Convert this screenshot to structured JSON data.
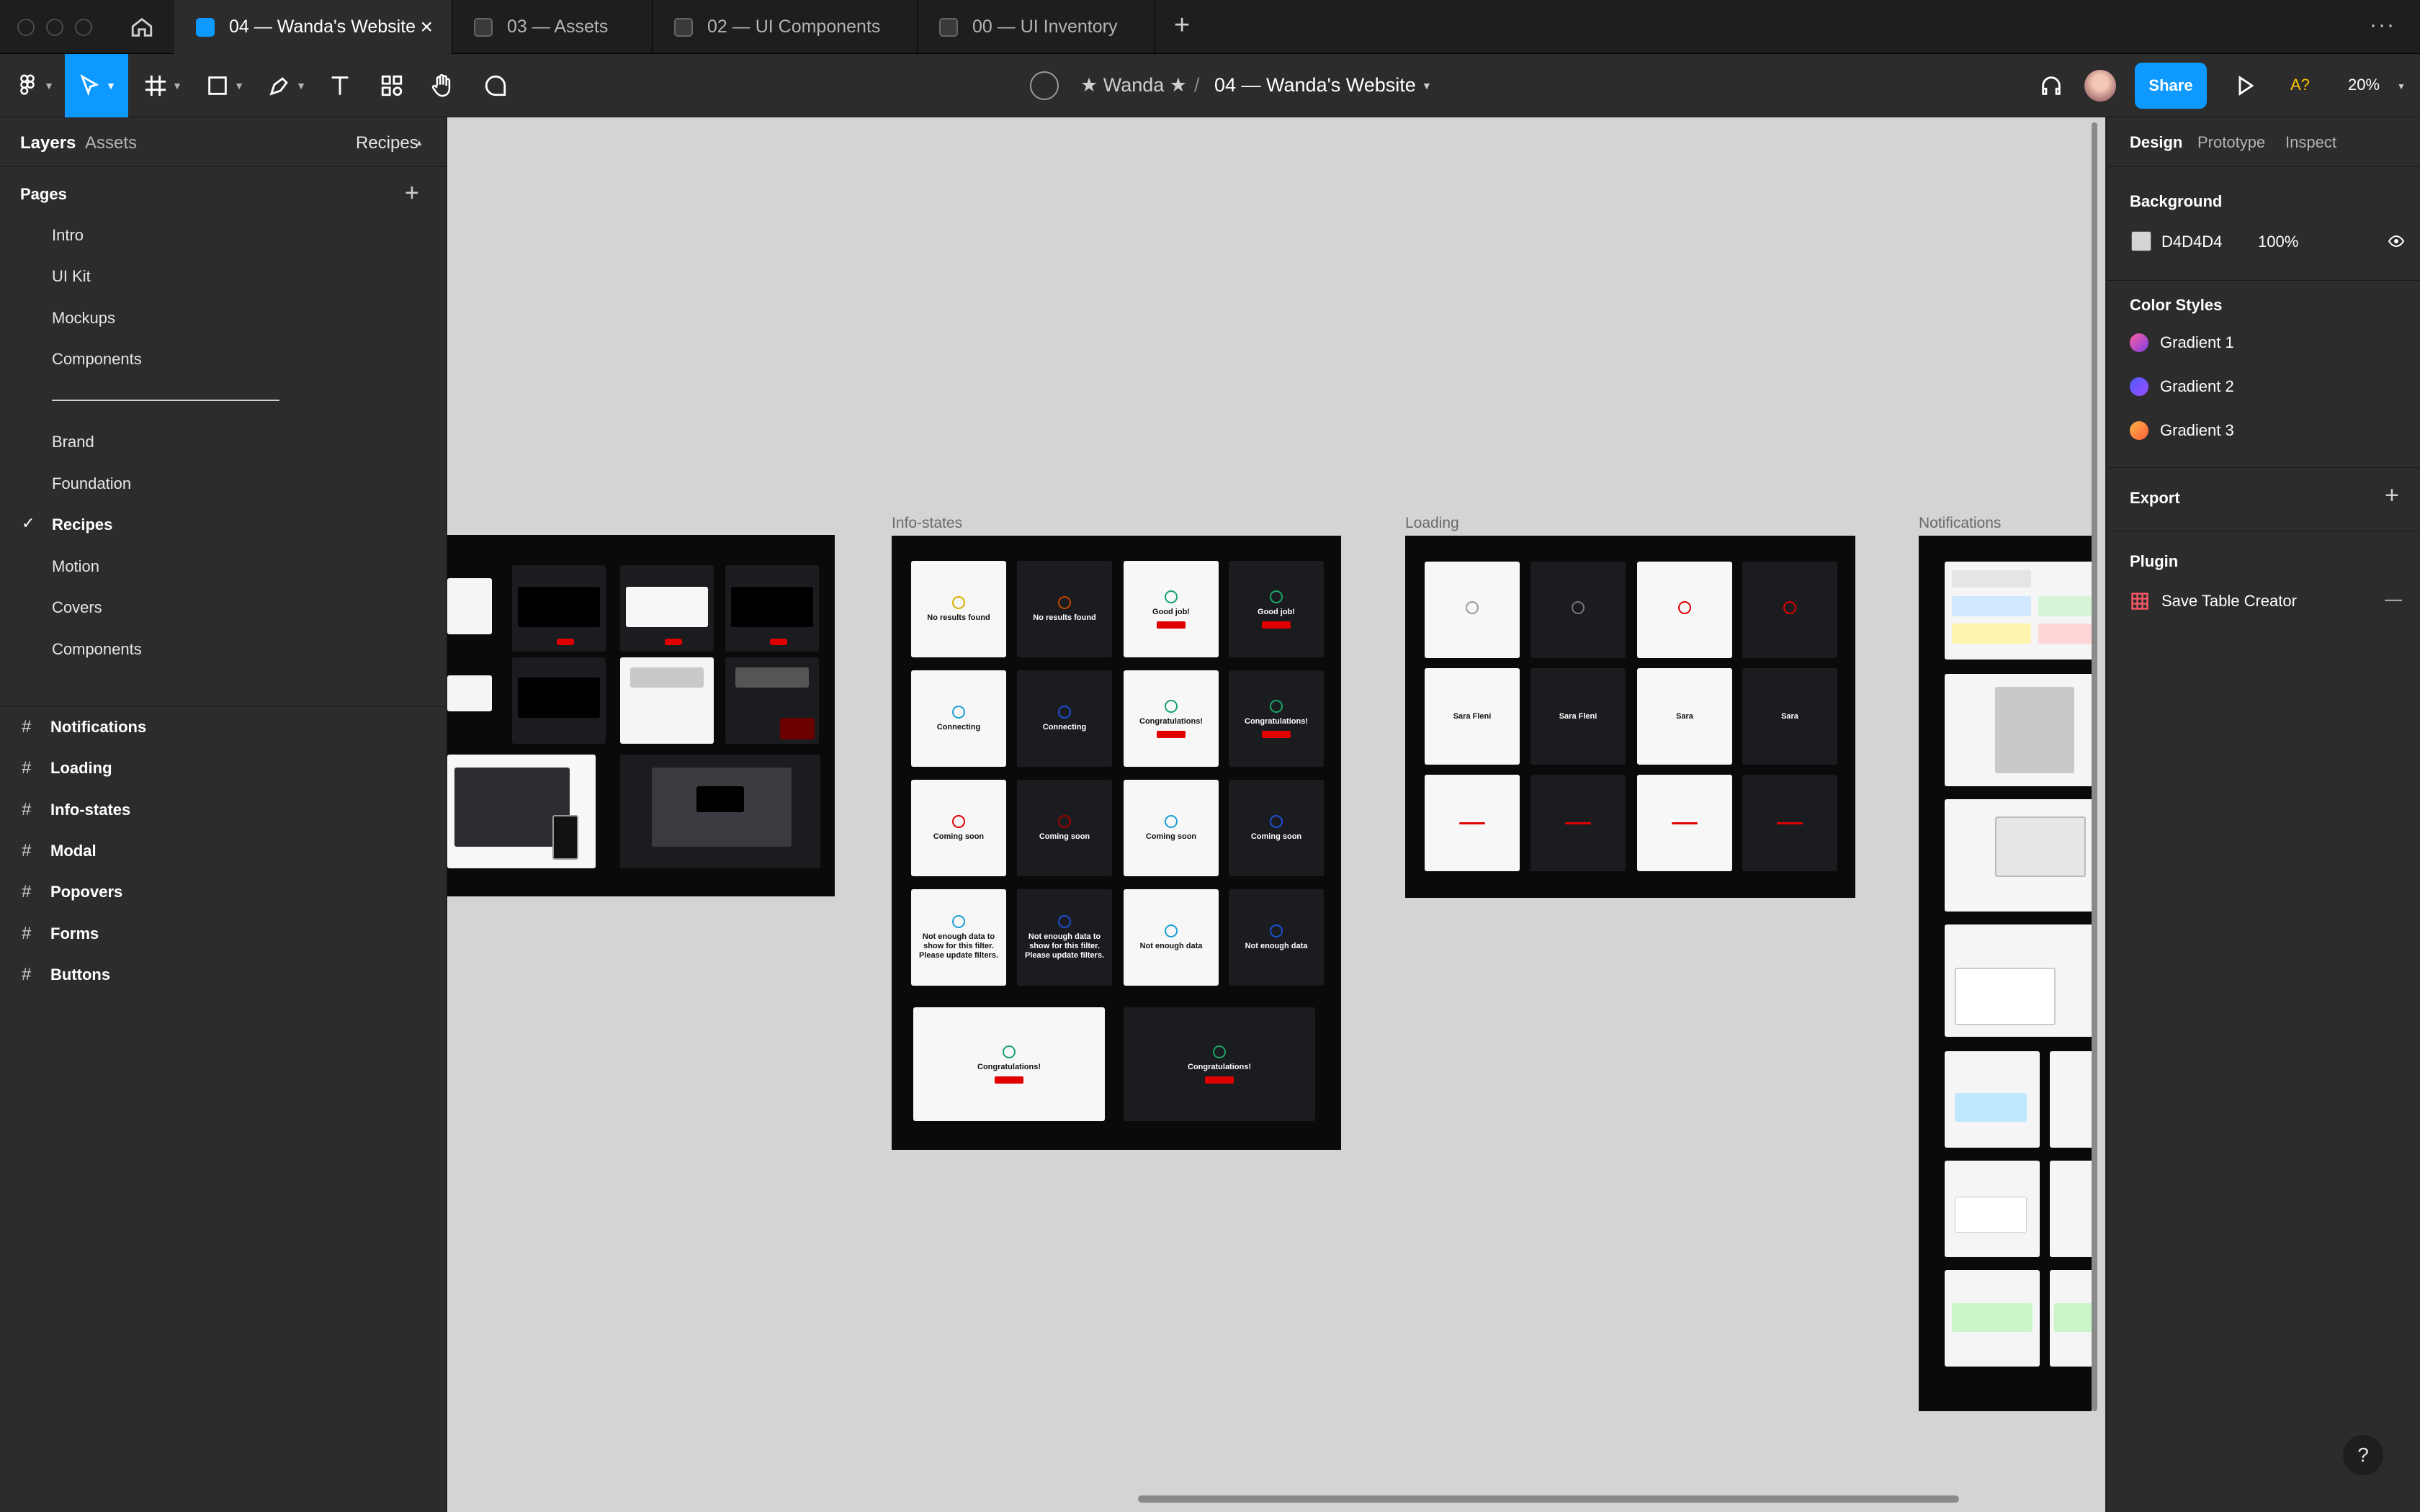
{
  "tabs": [
    {
      "label": "04 — Wanda's Website",
      "active": true
    },
    {
      "label": "03 — Assets"
    },
    {
      "label": "02 — UI Components"
    },
    {
      "label": "00 — UI Inventory"
    }
  ],
  "tab_close": "×",
  "new_tab": "+",
  "more_menu": "···",
  "breadcrumb": {
    "team": "★ Wanda ★",
    "separator": "/",
    "file": "04 — Wanda's Website"
  },
  "share_label": "Share",
  "missing_fonts": "A?",
  "zoom": "20%",
  "left_tabs": {
    "layers": "Layers",
    "assets": "Assets",
    "recipes": "Recipes"
  },
  "pages_title": "Pages",
  "add_icon": "+",
  "pages": [
    "Intro",
    "UI Kit",
    "Mockups",
    "Components",
    "────────────────",
    "Brand",
    "Foundation",
    "Recipes",
    "Motion",
    "Covers",
    "Components"
  ],
  "current_page_check": "✓",
  "layers": [
    "Notifications",
    "Loading",
    "Info-states",
    "Modal",
    "Popovers",
    "Forms",
    "Buttons"
  ],
  "layer_hash": "#",
  "right_tabs": {
    "design": "Design",
    "prototype": "Prototype",
    "inspect": "Inspect"
  },
  "background": {
    "title": "Background",
    "hex": "D4D4D4",
    "opacity": "100%",
    "color": "#d4d4d4"
  },
  "color_styles": {
    "title": "Color Styles",
    "items": [
      {
        "name": "Gradient 1",
        "gradient": "linear-gradient(135deg,#ff5fa2,#7b3fe4)"
      },
      {
        "name": "Gradient 2",
        "gradient": "linear-gradient(135deg,#4a5cff,#a04bff)"
      },
      {
        "name": "Gradient 3",
        "gradient": "linear-gradient(135deg,#ffb347,#ff5e3a)"
      }
    ]
  },
  "export_title": "Export",
  "plugin": {
    "title": "Plugin",
    "item": "Save Table Creator",
    "remove": "—"
  },
  "help": "?",
  "frames": {
    "info_states": {
      "label": "Info-states",
      "cards": [
        {
          "t": "No results found"
        },
        {
          "t": "No results found"
        },
        {
          "t": "Good job!"
        },
        {
          "t": "Good job!"
        },
        {
          "t": "Connecting"
        },
        {
          "t": "Connecting"
        },
        {
          "t": "Congratulations!"
        },
        {
          "t": "Congratulations!"
        },
        {
          "t": "Coming soon"
        },
        {
          "t": "Coming soon"
        },
        {
          "t": "Coming soon"
        },
        {
          "t": "Coming soon"
        },
        {
          "t": "Not enough data to show for this filter. Please update filters."
        },
        {
          "t": "Not enough data to show for this filter. Please update filters."
        },
        {
          "t": "Not enough data"
        },
        {
          "t": "Not enough data"
        },
        {
          "t": "Congratulations!"
        },
        {
          "t": "Congratulations!"
        }
      ]
    },
    "loading": {
      "label": "Loading",
      "names": [
        "Sara Fleni",
        "Sara Fleni",
        "Sara",
        "Sara"
      ]
    },
    "notifications": {
      "label": "Notifications"
    }
  },
  "colors": {
    "accent": "#0d99ff",
    "danger": "#e10000",
    "canvas": "#d4d4d4"
  }
}
